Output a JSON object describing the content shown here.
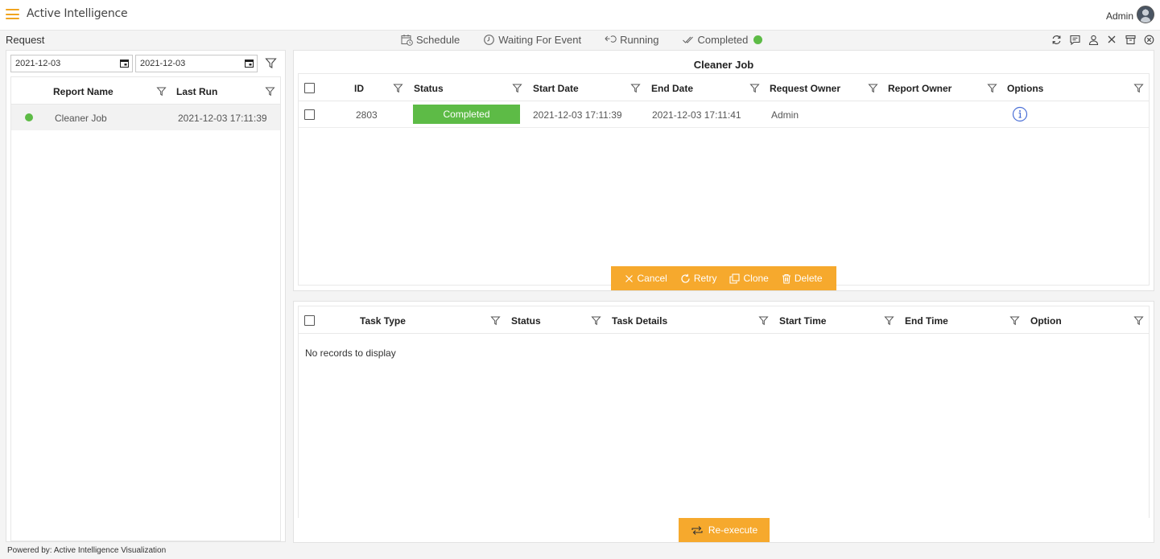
{
  "app": {
    "title": "Active Intelligence",
    "user": "Admin"
  },
  "page": {
    "title": "Request"
  },
  "status_tabs": [
    {
      "label": "Schedule",
      "icon": "calendar-clock-icon"
    },
    {
      "label": "Waiting For Event",
      "icon": "timer-icon"
    },
    {
      "label": "Running",
      "icon": "running-icon"
    },
    {
      "label": "Completed",
      "icon": "check-icon"
    }
  ],
  "toolbar": [
    "refresh-icon",
    "message-icon",
    "user-icon",
    "close-icon",
    "archive-icon",
    "cancel-circle-icon"
  ],
  "filters": {
    "from_date": "2021-12-03",
    "to_date": "2021-12-03"
  },
  "request_list": {
    "columns": [
      "Report Name",
      "Last Run"
    ],
    "rows": [
      {
        "name": "Cleaner Job",
        "last_run": "2021-12-03 17:11:39"
      }
    ]
  },
  "job_panel": {
    "title": "Cleaner Job",
    "columns": [
      "ID",
      "Status",
      "Start Date",
      "End Date",
      "Request Owner",
      "Report Owner",
      "Options"
    ],
    "rows": [
      {
        "id": "2803",
        "status": "Completed",
        "start_date": "2021-12-03 17:11:39",
        "end_date": "2021-12-03 17:11:41",
        "request_owner": "Admin",
        "report_owner": ""
      }
    ],
    "actions": {
      "cancel": "Cancel",
      "retry": "Retry",
      "clone": "Clone",
      "delete": "Delete"
    }
  },
  "task_panel": {
    "columns": [
      "Task Type",
      "Status",
      "Task Details",
      "Start Time",
      "End Time",
      "Option"
    ],
    "empty_text": "No records to display",
    "reexecute_label": "Re-execute"
  },
  "footer": {
    "text": "Powered by: Active Intelligence Visualization"
  },
  "colors": {
    "accent": "#f6a92d",
    "success": "#5dbb46",
    "info": "#4a6fd6"
  }
}
